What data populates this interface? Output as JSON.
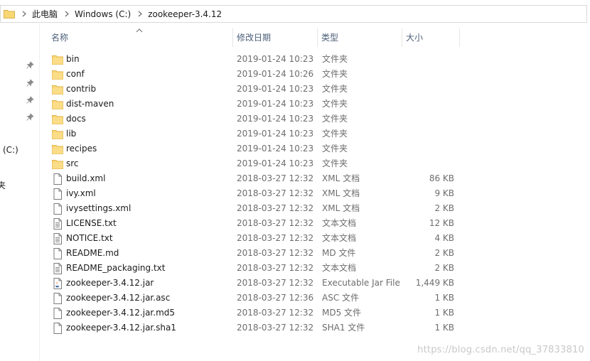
{
  "address": {
    "crumbs": [
      "此电脑",
      "Windows (C:)",
      "zookeeper-3.4.12"
    ]
  },
  "nav": {
    "drive_fragment": "(C:)",
    "folder_fragment": "夹"
  },
  "headers": {
    "name": "名称",
    "date": "修改日期",
    "type": "类型",
    "size": "大小"
  },
  "files": [
    {
      "name": "bin",
      "date": "2019-01-24 10:23",
      "type": "文件夹",
      "size": "",
      "icon": "folder-icon"
    },
    {
      "name": "conf",
      "date": "2019-01-24 10:26",
      "type": "文件夹",
      "size": "",
      "icon": "folder-icon"
    },
    {
      "name": "contrib",
      "date": "2019-01-24 10:23",
      "type": "文件夹",
      "size": "",
      "icon": "folder-icon"
    },
    {
      "name": "dist-maven",
      "date": "2019-01-24 10:23",
      "type": "文件夹",
      "size": "",
      "icon": "folder-icon"
    },
    {
      "name": "docs",
      "date": "2019-01-24 10:23",
      "type": "文件夹",
      "size": "",
      "icon": "folder-icon"
    },
    {
      "name": "lib",
      "date": "2019-01-24 10:23",
      "type": "文件夹",
      "size": "",
      "icon": "folder-icon"
    },
    {
      "name": "recipes",
      "date": "2019-01-24 10:23",
      "type": "文件夹",
      "size": "",
      "icon": "folder-icon"
    },
    {
      "name": "src",
      "date": "2019-01-24 10:23",
      "type": "文件夹",
      "size": "",
      "icon": "folder-icon"
    },
    {
      "name": "build.xml",
      "date": "2018-03-27 12:32",
      "type": "XML 文档",
      "size": "86 KB",
      "icon": "document-icon"
    },
    {
      "name": "ivy.xml",
      "date": "2018-03-27 12:32",
      "type": "XML 文档",
      "size": "9 KB",
      "icon": "document-icon"
    },
    {
      "name": "ivysettings.xml",
      "date": "2018-03-27 12:32",
      "type": "XML 文档",
      "size": "2 KB",
      "icon": "document-icon"
    },
    {
      "name": "LICENSE.txt",
      "date": "2018-03-27 12:32",
      "type": "文本文档",
      "size": "12 KB",
      "icon": "text-file-icon"
    },
    {
      "name": "NOTICE.txt",
      "date": "2018-03-27 12:32",
      "type": "文本文档",
      "size": "4 KB",
      "icon": "text-file-icon"
    },
    {
      "name": "README.md",
      "date": "2018-03-27 12:32",
      "type": "MD 文件",
      "size": "2 KB",
      "icon": "document-icon"
    },
    {
      "name": "README_packaging.txt",
      "date": "2018-03-27 12:32",
      "type": "文本文档",
      "size": "2 KB",
      "icon": "text-file-icon"
    },
    {
      "name": "zookeeper-3.4.12.jar",
      "date": "2018-03-27 12:32",
      "type": "Executable Jar File",
      "size": "1,449 KB",
      "icon": "jar-file-icon"
    },
    {
      "name": "zookeeper-3.4.12.jar.asc",
      "date": "2018-03-27 12:36",
      "type": "ASC 文件",
      "size": "1 KB",
      "icon": "document-icon"
    },
    {
      "name": "zookeeper-3.4.12.jar.md5",
      "date": "2018-03-27 12:32",
      "type": "MD5 文件",
      "size": "1 KB",
      "icon": "document-icon"
    },
    {
      "name": "zookeeper-3.4.12.jar.sha1",
      "date": "2018-03-27 12:32",
      "type": "SHA1 文件",
      "size": "1 KB",
      "icon": "document-icon"
    }
  ],
  "watermark": "https://blog.csdn.net/qq_37833810",
  "colors": {
    "folder": "#f8d775",
    "header_text": "#4c607a",
    "secondary_text": "#6d6d6d"
  }
}
